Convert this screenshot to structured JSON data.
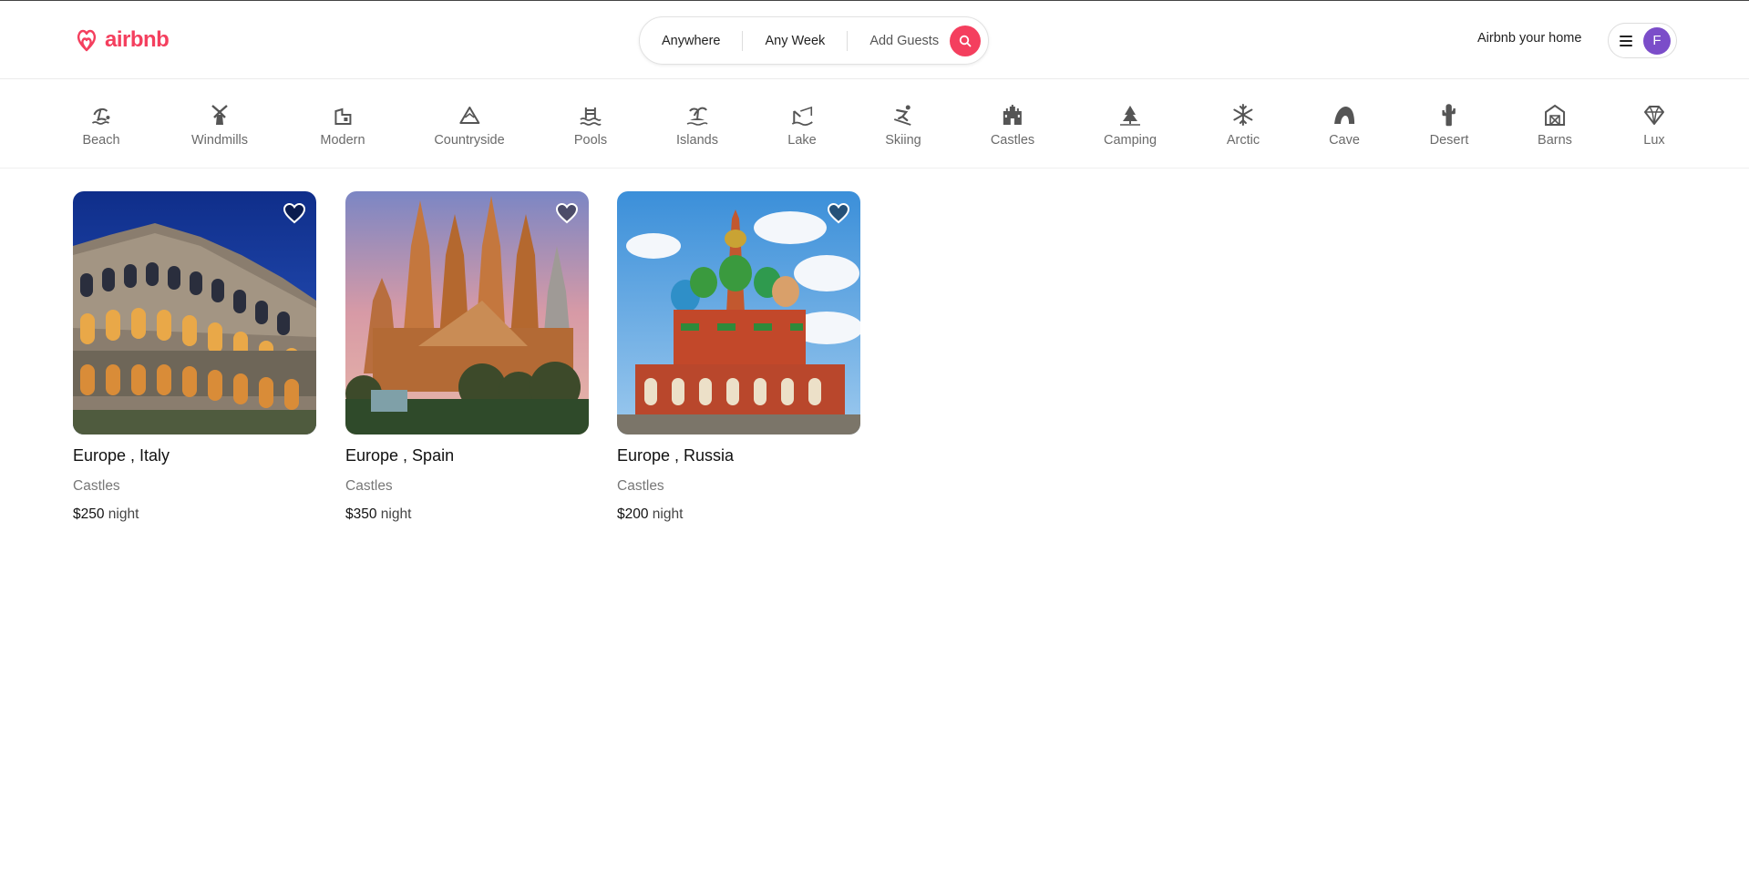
{
  "brand": {
    "name": "airbnb",
    "color": "#f43f5e"
  },
  "search": {
    "where": "Anywhere",
    "when": "Any Week",
    "who": "Add Guests",
    "icon": "search-icon"
  },
  "header": {
    "host_link": "Airbnb your home",
    "menu_icon": "hamburger-icon",
    "avatar_initial": "F",
    "avatar_color": "#7b4dc9"
  },
  "categories": [
    {
      "label": "Beach",
      "icon": "beach-icon"
    },
    {
      "label": "Windmills",
      "icon": "windmill-icon"
    },
    {
      "label": "Modern",
      "icon": "modern-house-icon"
    },
    {
      "label": "Countryside",
      "icon": "mountain-icon"
    },
    {
      "label": "Pools",
      "icon": "pool-icon"
    },
    {
      "label": "Islands",
      "icon": "island-icon"
    },
    {
      "label": "Lake",
      "icon": "lake-icon"
    },
    {
      "label": "Skiing",
      "icon": "skiing-icon"
    },
    {
      "label": "Castles",
      "icon": "castle-icon"
    },
    {
      "label": "Camping",
      "icon": "camping-icon"
    },
    {
      "label": "Arctic",
      "icon": "snowflake-icon"
    },
    {
      "label": "Cave",
      "icon": "cave-icon"
    },
    {
      "label": "Desert",
      "icon": "cactus-icon"
    },
    {
      "label": "Barns",
      "icon": "barn-icon"
    },
    {
      "label": "Lux",
      "icon": "diamond-icon"
    }
  ],
  "listings": [
    {
      "location": "Europe , Italy",
      "category": "Castles",
      "price": "$250",
      "unit": "night"
    },
    {
      "location": "Europe , Spain",
      "category": "Castles",
      "price": "$350",
      "unit": "night"
    },
    {
      "location": "Europe , Russia",
      "category": "Castles",
      "price": "$200",
      "unit": "night"
    }
  ]
}
